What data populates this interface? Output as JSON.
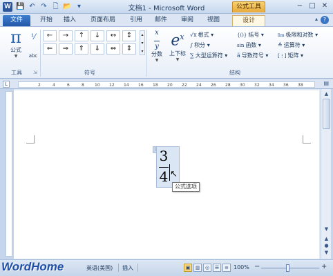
{
  "window": {
    "title": "文档1 - Microsoft Word",
    "app_icon": "W",
    "qat_icons": [
      "save-icon",
      "undo-icon",
      "redo-icon",
      "new-doc-icon",
      "open-folder-icon",
      "customize-qat-icon"
    ]
  },
  "context_tab_header": "公式工具",
  "tabs": [
    {
      "label": "文件"
    },
    {
      "label": "开始"
    },
    {
      "label": "插入"
    },
    {
      "label": "页面布局"
    },
    {
      "label": "引用"
    },
    {
      "label": "邮件"
    },
    {
      "label": "审阅"
    },
    {
      "label": "视图"
    },
    {
      "label": "设计"
    }
  ],
  "ribbon": {
    "tools": {
      "formula_label": "公式",
      "abc_label": "abc",
      "group_label": "工具"
    },
    "symbols": {
      "row1": [
        "←",
        "→",
        "↑",
        "↓",
        "↔",
        "↕"
      ],
      "row2": [
        "⇐",
        "⇒",
        "⇑",
        "⇓",
        "⇔",
        "⇕"
      ],
      "group_label": "符号"
    },
    "structures": {
      "fraction": {
        "glyph": "x/y",
        "label": "分数"
      },
      "script": {
        "glyph": "eˣ",
        "label": "上下标"
      },
      "radical": {
        "glyph": "√x",
        "label": "根式"
      },
      "integral": {
        "glyph": "∫",
        "label": "积分"
      },
      "large_op": {
        "glyph": "∑",
        "label": "大型运算符"
      },
      "bracket": {
        "glyph": "{()}",
        "label": "括号"
      },
      "function": {
        "glyph": "sin",
        "label": "函数"
      },
      "accent": {
        "glyph": "ä",
        "label": "导数符号"
      },
      "limit": {
        "glyph": "lim",
        "label": "极限和对数"
      },
      "operator": {
        "glyph": "≜",
        "label": "运算符"
      },
      "matrix": {
        "glyph": "[⋮]",
        "label": "矩阵"
      },
      "group_label": "结构"
    }
  },
  "ruler": {
    "box_label": "L",
    "numbers": [
      "2",
      "4",
      "6",
      "8",
      "10",
      "12",
      "14",
      "16",
      "18",
      "20",
      "22",
      "24",
      "26",
      "28",
      "30",
      "32",
      "34",
      "36",
      "38"
    ]
  },
  "document": {
    "equation": {
      "numerator": "3",
      "denominator": "4"
    },
    "tooltip": "公式选项"
  },
  "statusbar": {
    "watermark": "WordHome",
    "language": "英语(美国)",
    "mode": "插入",
    "zoom": "100%",
    "zoom_minus": "−",
    "zoom_plus": "+"
  }
}
